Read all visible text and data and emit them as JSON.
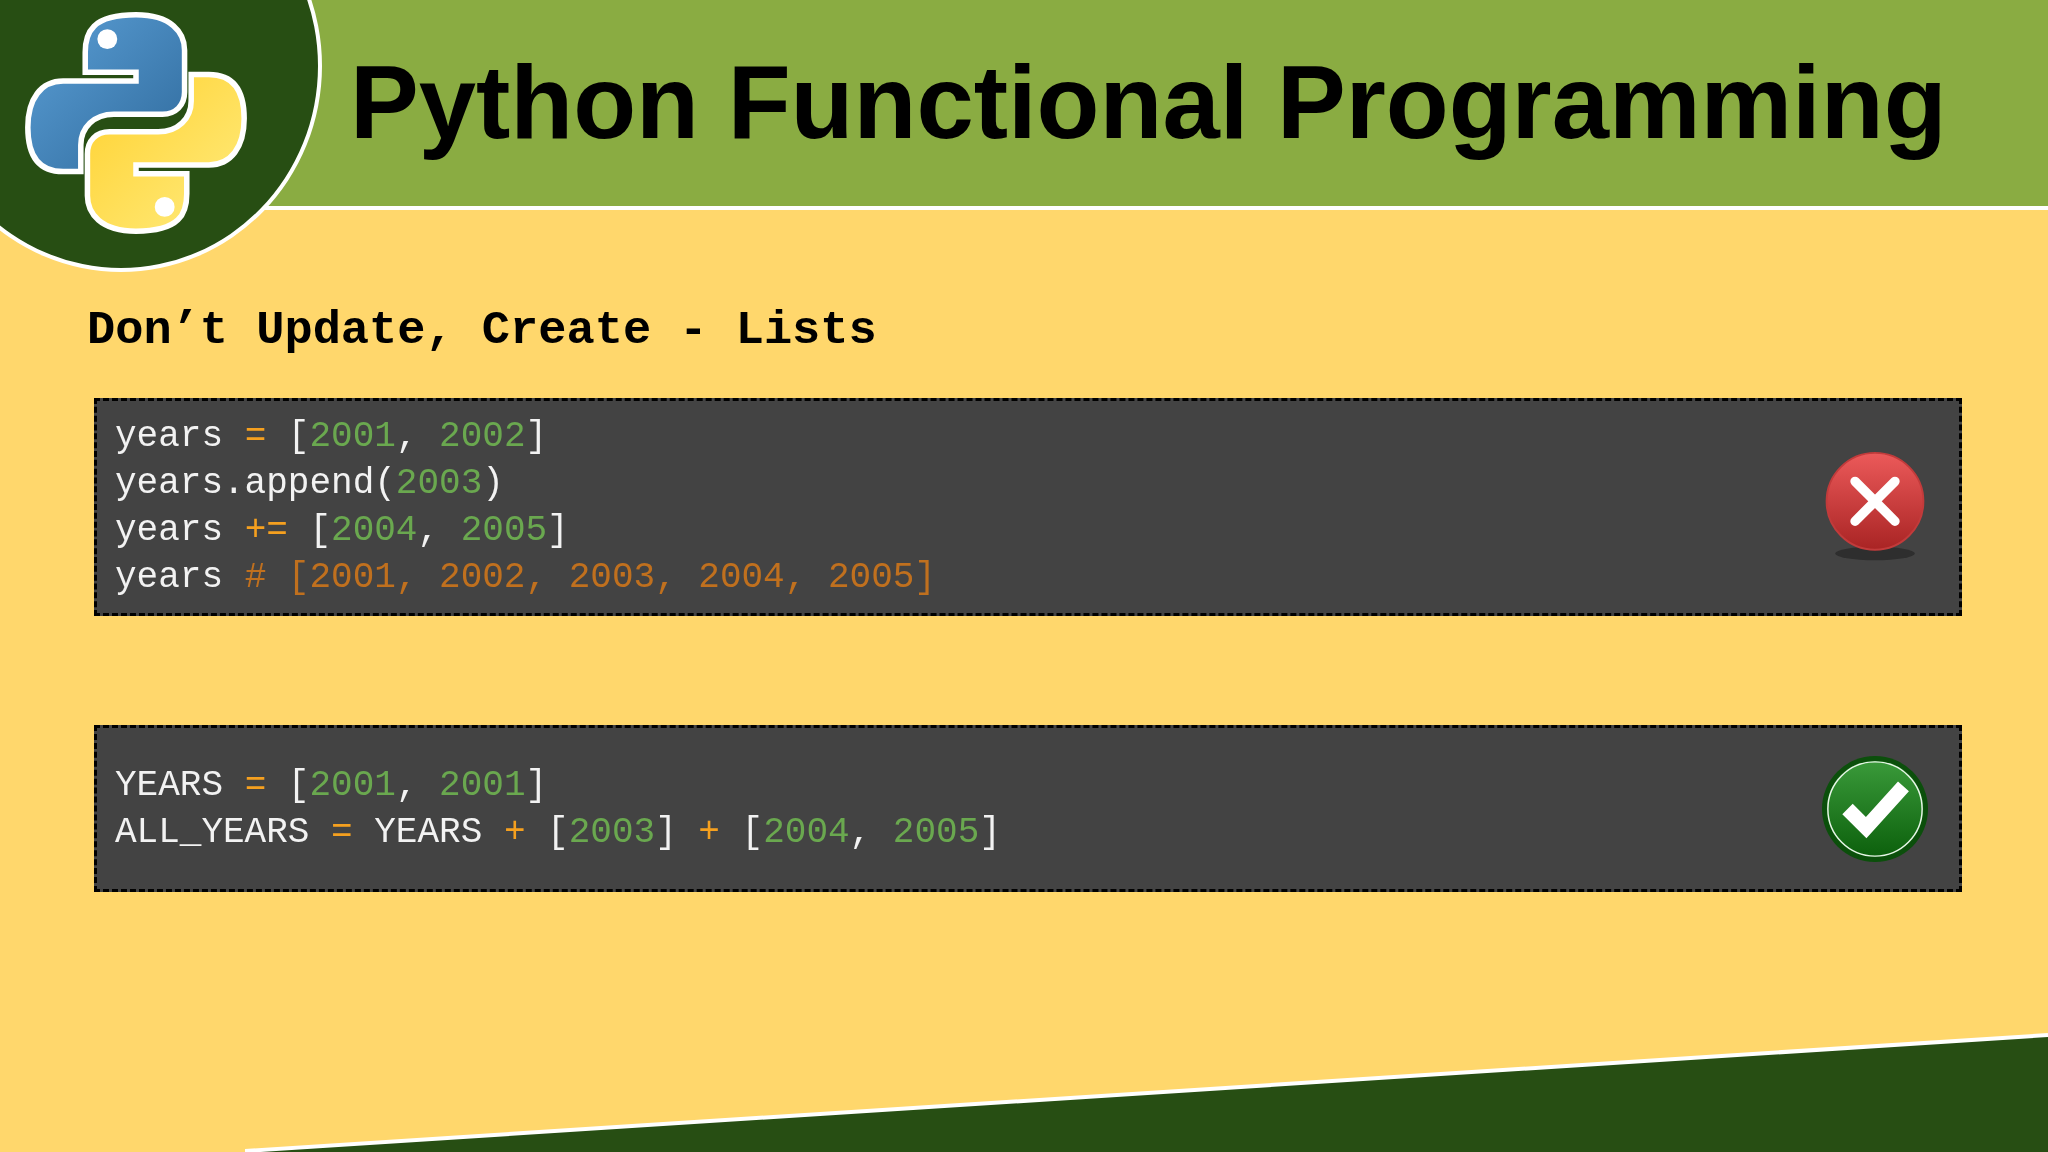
{
  "header": {
    "title": "Python Functional Programming"
  },
  "heading": "Don’t Update, Create - Lists",
  "code_blocks": [
    {
      "correct": false,
      "lines": [
        [
          {
            "kind": "name",
            "text": "years "
          },
          {
            "kind": "operator",
            "text": "= "
          },
          {
            "kind": "punct",
            "text": "["
          },
          {
            "kind": "number",
            "text": "2001"
          },
          {
            "kind": "punct",
            "text": ", "
          },
          {
            "kind": "number",
            "text": "2002"
          },
          {
            "kind": "punct",
            "text": "]"
          }
        ],
        [
          {
            "kind": "name",
            "text": "years.append("
          },
          {
            "kind": "number",
            "text": "2003"
          },
          {
            "kind": "punct",
            "text": ")"
          }
        ],
        [
          {
            "kind": "name",
            "text": "years "
          },
          {
            "kind": "operator",
            "text": "+= "
          },
          {
            "kind": "punct",
            "text": "["
          },
          {
            "kind": "number",
            "text": "2004"
          },
          {
            "kind": "punct",
            "text": ", "
          },
          {
            "kind": "number",
            "text": "2005"
          },
          {
            "kind": "punct",
            "text": "]"
          }
        ],
        [
          {
            "kind": "name",
            "text": "years "
          },
          {
            "kind": "comment",
            "text": "# [2001, 2002, 2003, 2004, 2005]"
          }
        ]
      ]
    },
    {
      "correct": true,
      "lines": [
        [
          {
            "kind": "name",
            "text": "YEARS "
          },
          {
            "kind": "operator",
            "text": "= "
          },
          {
            "kind": "punct",
            "text": "["
          },
          {
            "kind": "number",
            "text": "2001"
          },
          {
            "kind": "punct",
            "text": ", "
          },
          {
            "kind": "number",
            "text": "2001"
          },
          {
            "kind": "punct",
            "text": "]"
          }
        ],
        [
          {
            "kind": "name",
            "text": "ALL_YEARS "
          },
          {
            "kind": "operator",
            "text": "= "
          },
          {
            "kind": "name",
            "text": "YEARS "
          },
          {
            "kind": "operator",
            "text": "+ "
          },
          {
            "kind": "punct",
            "text": "["
          },
          {
            "kind": "number",
            "text": "2003"
          },
          {
            "kind": "punct",
            "text": "] "
          },
          {
            "kind": "operator",
            "text": "+ "
          },
          {
            "kind": "punct",
            "text": "["
          },
          {
            "kind": "number",
            "text": "2004"
          },
          {
            "kind": "punct",
            "text": ", "
          },
          {
            "kind": "number",
            "text": "2005"
          },
          {
            "kind": "punct",
            "text": "]"
          }
        ]
      ]
    }
  ]
}
